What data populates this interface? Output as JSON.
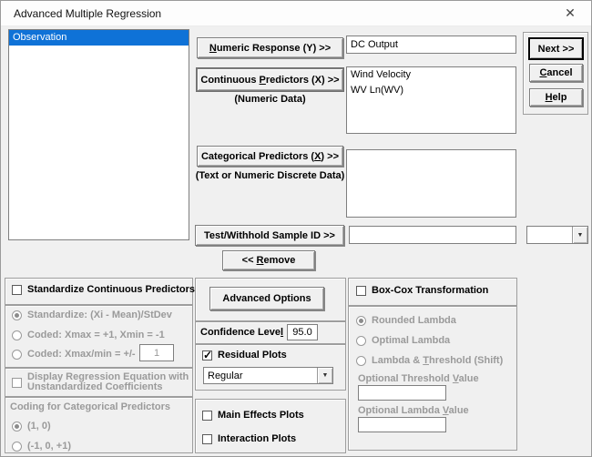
{
  "window": {
    "title": "Advanced Multiple Regression",
    "close_glyph": "✕"
  },
  "source_list": {
    "items": [
      {
        "label": "Observation",
        "selected": true
      }
    ]
  },
  "form": {
    "numeric_response": {
      "btn_key": "N",
      "btn_post": "umeric Response (Y) >>",
      "value": "DC Output"
    },
    "continuous": {
      "btn_pre": "Continuous ",
      "btn_key": "P",
      "btn_post": "redictors (X) >>",
      "note": "(Numeric Data)",
      "items": [
        "Wind Velocity",
        "WV Ln(WV)"
      ]
    },
    "categorical": {
      "btn_pre": "Categorical Predictors (",
      "btn_key": "X",
      "btn_post": ") >>",
      "note": "(Text or Numeric Discrete Data)",
      "items": []
    },
    "test_withhold": {
      "btn": "Test/Withhold Sample ID >>",
      "value": "",
      "combo_value": ""
    },
    "remove": {
      "pre": "<< ",
      "key": "R",
      "post": "emove"
    }
  },
  "actions": {
    "next": "Next >>",
    "cancel_key": "C",
    "cancel_post": "ancel",
    "help_key": "H",
    "help_post": "elp"
  },
  "standardize": {
    "title": "Standardize Continuous Predictors",
    "checked": false,
    "options": [
      {
        "label": "Standardize: (Xi - Mean)/StDev",
        "selected": true
      },
      {
        "label": "Coded: Xmax = +1, Xmin = -1",
        "selected": false
      },
      {
        "label": "Coded: Xmax/min = +/-",
        "selected": false,
        "value": "1"
      }
    ]
  },
  "display_equation": {
    "checked": false,
    "line1": "Display Regression Equation with",
    "line2": "Unstandardized Coefficients"
  },
  "coding": {
    "title": "Coding for Categorical Predictors",
    "options": [
      {
        "label": "(1, 0)",
        "selected": true
      },
      {
        "label": "(-1, 0, +1)",
        "selected": false
      }
    ]
  },
  "middle": {
    "advanced_options": "Advanced Options",
    "confidence": {
      "label_pre": "Confidence Leve",
      "label_key": "l",
      "value": "95.0"
    },
    "residual": {
      "label": "Residual Plots",
      "checked": true,
      "dropdown_value": "Regular"
    },
    "main_effects": {
      "label": "Main Effects Plots",
      "checked": false
    },
    "interaction": {
      "label": "Interaction Plots",
      "checked": false
    }
  },
  "boxcox": {
    "title": "Box-Cox Transformation",
    "checked": false,
    "rounded": {
      "label": "Rounded Lambda",
      "selected": true
    },
    "optimal": {
      "label": "Optimal Lambda",
      "selected": false
    },
    "lambda_threshold": {
      "pre": "Lambda & ",
      "key": "T",
      "post": "hreshold (Shift)",
      "selected": false
    },
    "threshold_label": {
      "pre": "Optional Threshold ",
      "key": "V",
      "post": "alue"
    },
    "lambda_label": {
      "pre": "Optional Lambda ",
      "key": "V",
      "post": "alue"
    },
    "threshold_value": "",
    "lambda_value": ""
  }
}
